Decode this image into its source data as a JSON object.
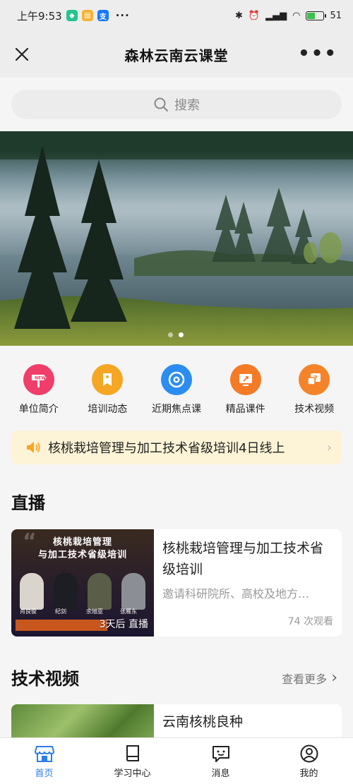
{
  "status_bar": {
    "time": "上午9:53",
    "app_icons": [
      "shield-app-icon",
      "notes-app-icon",
      "alipay-icon"
    ],
    "more": "···",
    "battery_percent": "51",
    "battery_level": 0.51
  },
  "header": {
    "title": "森林云南云课堂",
    "close_icon": "close-icon",
    "menu_icon": "more-dots-icon",
    "menu_text": "•••"
  },
  "search": {
    "placeholder": "搜索"
  },
  "banner": {
    "slides": 2,
    "active_slide": 2
  },
  "nav": [
    {
      "label": "单位简介",
      "icon": "new-signpost-icon",
      "color": "#ef3e6a"
    },
    {
      "label": "培训动态",
      "icon": "tag-icon",
      "color": "#f5a623"
    },
    {
      "label": "近期焦点课",
      "icon": "focus-target-icon",
      "color": "#2c8df0"
    },
    {
      "label": "精品课件",
      "icon": "presentation-icon",
      "color": "#f57a26"
    },
    {
      "label": "技术视频",
      "icon": "video-chat-icon",
      "color": "#f5832a"
    }
  ],
  "notice": {
    "icon": "speaker-icon",
    "text": "核桃栽培管理与加工技术省级培训4日线上"
  },
  "live": {
    "section_title": "直播",
    "card": {
      "title": "核桃栽培管理与加工技术省级培训",
      "description": "邀请科研院所、高校及地方…",
      "views": "74 次观看",
      "badge": "3天后 直播",
      "poster_title_line1": "核桃栽培管理",
      "poster_title_line2": "与加工技术省级培训",
      "speakers": [
        "肖良俊",
        "纪剑",
        "余旭亚",
        "张雁东"
      ]
    }
  },
  "videos": {
    "section_title": "技术视频",
    "more": "查看更多",
    "first_item_title": "云南核桃良种"
  },
  "tabbar": [
    {
      "label": "首页",
      "icon": "home-store-icon",
      "active": true
    },
    {
      "label": "学习中心",
      "icon": "book-icon",
      "active": false
    },
    {
      "label": "消息",
      "icon": "message-icon",
      "active": false
    },
    {
      "label": "我的",
      "icon": "profile-icon",
      "active": false
    }
  ],
  "colors": {
    "accent": "#2b7de9",
    "notice_bg": "#fdf3d6",
    "notice_icon": "#f5a623"
  }
}
